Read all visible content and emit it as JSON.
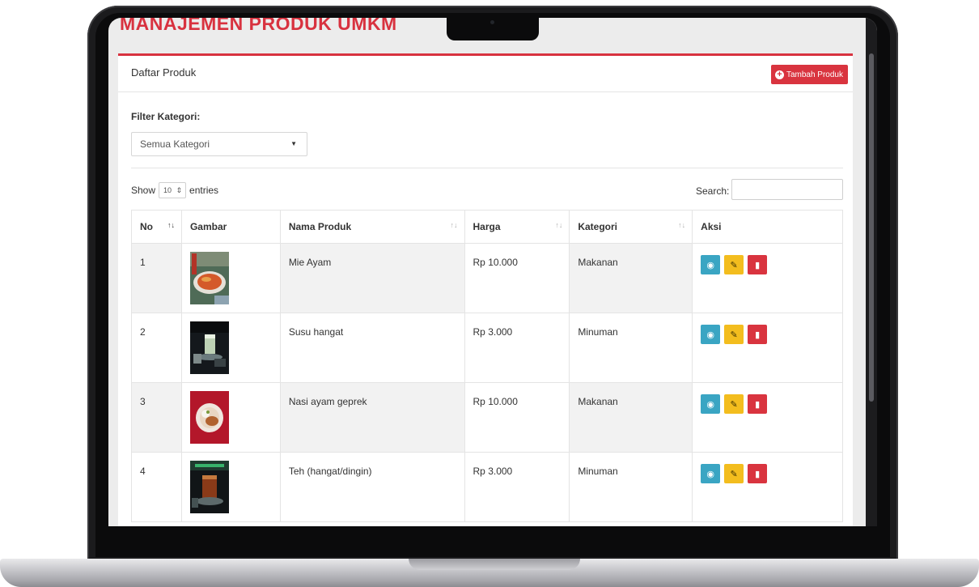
{
  "page": {
    "title": "MANAJEMEN PRODUK UMKM"
  },
  "card": {
    "title": "Daftar Produk",
    "add_button_label": "Tambah Produk"
  },
  "filter": {
    "label": "Filter Kategori:",
    "selected": "Semua Kategori"
  },
  "datatable": {
    "show_label": "Show",
    "length_value": "10",
    "entries_label": "entries",
    "search_label": "Search:",
    "search_value": ""
  },
  "table": {
    "columns": [
      "No",
      "Gambar",
      "Nama Produk",
      "Harga",
      "Kategori",
      "Aksi"
    ],
    "rows": [
      {
        "no": "1",
        "name": "Mie Ayam",
        "price": "Rp 10.000",
        "category": "Makanan"
      },
      {
        "no": "2",
        "name": "Susu hangat",
        "price": "Rp 3.000",
        "category": "Minuman"
      },
      {
        "no": "3",
        "name": "Nasi ayam geprek",
        "price": "Rp 10.000",
        "category": "Makanan"
      },
      {
        "no": "4",
        "name": "Teh (hangat/dingin)",
        "price": "Rp 3.000",
        "category": "Minuman"
      }
    ]
  },
  "icons": {
    "add": "plus-circle-icon",
    "view": "eye-icon",
    "edit": "edit-icon",
    "delete": "trash-icon"
  },
  "colors": {
    "brand_red": "#d9343f",
    "view_button": "#3aa5c3",
    "edit_button": "#f3bd1e",
    "delete_button": "#d9343f"
  }
}
